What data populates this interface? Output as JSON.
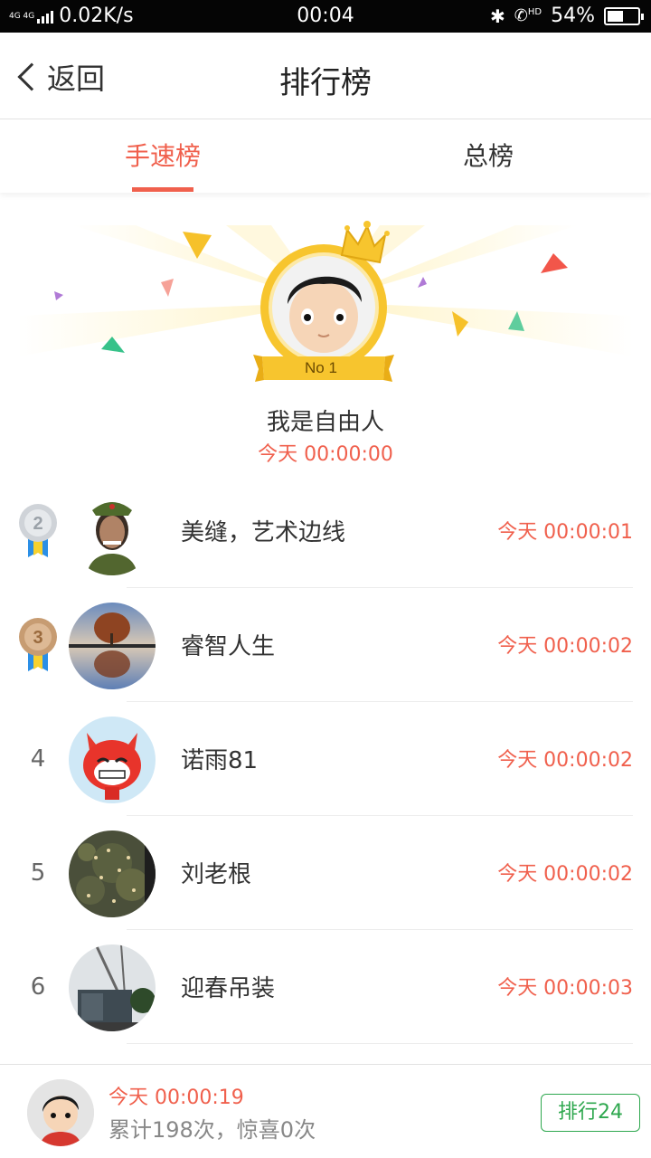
{
  "status_bar": {
    "network": "4G 4G",
    "speed": "0.02K/s",
    "time": "00:04",
    "hd": "HD",
    "battery_percent": "54%",
    "battery_level": 0.54
  },
  "nav": {
    "back_label": "返回",
    "title": "排行榜"
  },
  "tabs": [
    {
      "label": "手速榜",
      "active": true
    },
    {
      "label": "总榜",
      "active": false
    }
  ],
  "champion": {
    "badge": "No 1",
    "name": "我是自由人",
    "time": "今天 00:00:00"
  },
  "ranking": [
    {
      "rank": "2",
      "name": "美缝，艺术边线",
      "time": "今天 00:00:01",
      "medal": "silver"
    },
    {
      "rank": "3",
      "name": "睿智人生",
      "time": "今天 00:00:02",
      "medal": "bronze"
    },
    {
      "rank": "4",
      "name": "诺雨81",
      "time": "今天 00:00:02"
    },
    {
      "rank": "5",
      "name": "刘老根",
      "time": "今天 00:00:02"
    },
    {
      "rank": "6",
      "name": "迎春吊装",
      "time": "今天 00:00:03"
    }
  ],
  "footer": {
    "time": "今天 00:00:19",
    "stats": "累计198次，惊喜0次",
    "rank_button": "排行24"
  },
  "colors": {
    "accent_red": "#f0604d",
    "accent_green": "#2fa84f",
    "gold": "#f7c52e"
  }
}
